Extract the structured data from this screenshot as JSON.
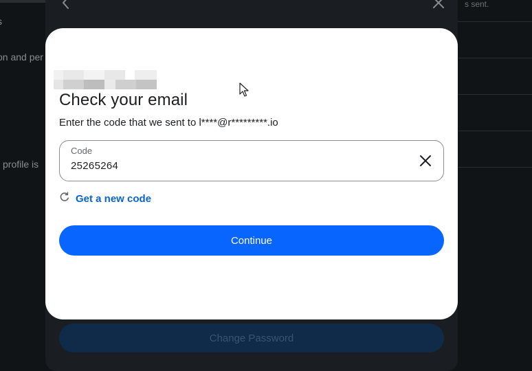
{
  "background": {
    "left_texts": [
      "s",
      "on and per",
      "profile is"
    ],
    "sent_text": "s sent.",
    "change_password_label": "Change Password",
    "back_icon": "chevron-left-icon",
    "close_icon": "close-icon"
  },
  "modal": {
    "title": "Check your email",
    "subtitle": "Enter the code that we sent to l****@r*********.io",
    "code_field": {
      "label": "Code",
      "value": "25265264"
    },
    "clear_icon": "close-icon",
    "resend": {
      "icon": "refresh-icon",
      "label": "Get a new code"
    },
    "continue_label": "Continue"
  },
  "colors": {
    "primary": "#0866ff",
    "link": "#0a64c8",
    "backdrop": "#111416"
  }
}
